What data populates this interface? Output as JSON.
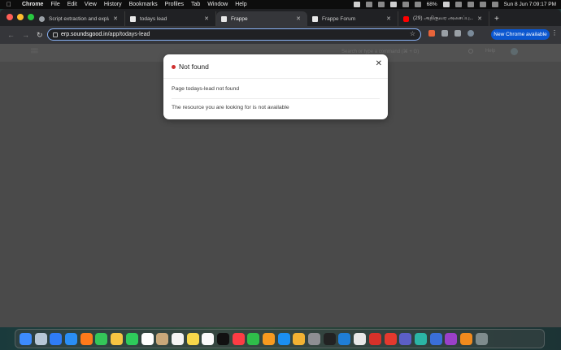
{
  "menubar": {
    "app_name": "Chrome",
    "menus": [
      "File",
      "Edit",
      "View",
      "History",
      "Bookmarks",
      "Profiles",
      "Tab",
      "Window",
      "Help"
    ],
    "battery": "68%",
    "datetime": "Sun 8 Jun  7:09:17 PM"
  },
  "tabs": [
    {
      "title": "Script extraction and explana",
      "favicon": "chatgpt-icon",
      "active": false
    },
    {
      "title": "todays lead",
      "favicon": "frappe-icon",
      "active": false
    },
    {
      "title": "Frappe",
      "favicon": "frappe-icon",
      "active": true
    },
    {
      "title": "Frappe Forum",
      "favicon": "frappe-icon",
      "active": false
    },
    {
      "title": "(29) அதிகுவர அசைப்பு... இதோ...",
      "favicon": "youtube-icon",
      "active": false
    }
  ],
  "toolbar": {
    "url_host": "erp.soundsgood.in",
    "url_path": "/app/todays-lead",
    "new_chrome_label": "New Chrome available"
  },
  "app_header": {
    "search_placeholder": "Search or type a command (⌘ + G)",
    "help_label": "Help"
  },
  "modal": {
    "title": "Not found",
    "message": "Page todays-lead not found",
    "detail": "The resource you are looking for is not available",
    "status_color": "#d0302f"
  },
  "dock": {
    "icons": [
      "finder-icon",
      "launchpad-icon",
      "safari-icon",
      "mail-icon",
      "firefox-icon",
      "messages-icon",
      "photos-icon",
      "facetime-icon",
      "calendar-icon",
      "contacts-icon",
      "reminders-icon",
      "notes-icon",
      "freeform-icon",
      "appletv-icon",
      "music-icon",
      "numbers-icon",
      "pages-icon",
      "keynote-icon",
      "finder-sticker-icon",
      "system-settings-icon",
      "terminal-icon",
      "vscode-icon",
      "chrome-icon",
      "wps-icon",
      "anydesk-icon",
      "teams-icon",
      "edge-icon",
      "proton-icon",
      "github-icon",
      "vlc-icon",
      "trash-icon"
    ]
  }
}
